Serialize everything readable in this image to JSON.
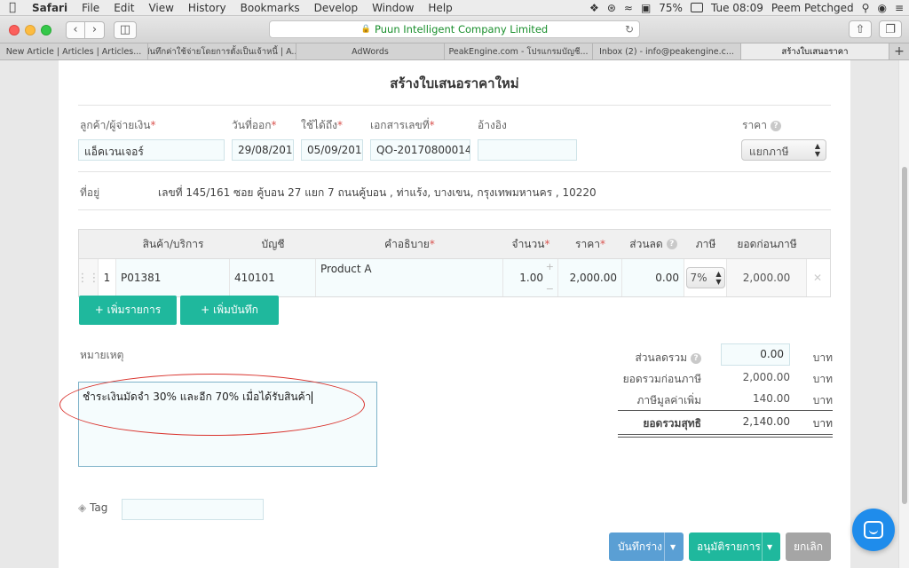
{
  "menubar": {
    "app": "Safari",
    "items": [
      "File",
      "Edit",
      "View",
      "History",
      "Bookmarks",
      "Develop",
      "Window",
      "Help"
    ],
    "battery": "75%",
    "clock": "Tue 08:09",
    "user": "Peem Petchged"
  },
  "browser": {
    "url": "Puun Intelligent Company Limited",
    "tabs": [
      "New Article | Articles | Articles...",
      "บันทึกค่าใช้จ่ายโดยการตั้งเป็นเจ้าหนี้ | A...",
      "AdWords",
      "PeakEngine.com - โปรแกรมบัญชี...",
      "Inbox (2) - info@peakengine.c...",
      "สร้างใบเสนอราคา"
    ],
    "active_tab": 5
  },
  "form": {
    "title": "สร้างใบเสนอราคาใหม่",
    "customer_label": "ลูกค้า/ผู้จ่ายเงิน",
    "customer_value": "แอ็คเวนเจอร์",
    "issue_date_label": "วันที่ออก",
    "issue_date_value": "29/08/2017",
    "valid_until_label": "ใช้ได้ถึง",
    "valid_until_value": "05/09/2017",
    "doc_no_label": "เอกสารเลขที่",
    "doc_no_value": "QO-20170800014",
    "reference_label": "อ้างอิง",
    "reference_value": "",
    "price_label": "ราคา",
    "price_type": "แยกภาษี",
    "address_label": "ที่อยู่",
    "address_value": "เลขที่ 145/161 ซอย คู้บอน 27 แยก 7 ถนนคู้บอน , ท่าแร้ง, บางเขน, กรุงเทพมหานคร , 10220"
  },
  "table": {
    "headers": {
      "product": "สินค้า/บริการ",
      "account": "บัญชี",
      "description": "คำอธิบาย",
      "qty": "จำนวน",
      "price": "ราคา",
      "discount": "ส่วนลด",
      "tax": "ภาษี",
      "pretax": "ยอดก่อนภาษี"
    },
    "rows": [
      {
        "no": "1",
        "product": "P01381",
        "account": "410101",
        "description": "Product A",
        "qty": "1.00",
        "price": "2,000.00",
        "discount": "0.00",
        "tax": "7%",
        "pretax": "2,000.00"
      }
    ],
    "add_item_label": "+ เพิ่มรายการ",
    "add_note_label": "+ เพิ่มบันทึก"
  },
  "remarks": {
    "label": "หมายเหตุ",
    "value": "ชำระเงินมัดจำ 30% และอีก 70% เมื่อได้รับสินค้า"
  },
  "summary": {
    "discount_label": "ส่วนลดรวม",
    "discount_value": "0.00",
    "pretax_label": "ยอดรวมก่อนภาษี",
    "pretax_value": "2,000.00",
    "vat_label": "ภาษีมูลค่าเพิ่ม",
    "vat_value": "140.00",
    "net_label": "ยอดรวมสุทธิ",
    "net_value": "2,140.00",
    "unit": "บาท"
  },
  "tag": {
    "label": "Tag",
    "value": ""
  },
  "actions": {
    "save_draft": "บันทึกร่าง",
    "approve": "อนุมัติรายการ",
    "cancel": "ยกเลิก"
  },
  "colors": {
    "accent": "#1fb89d",
    "draft_button": "#5a9fd4",
    "cancel_button": "#a5a5a5",
    "annotation": "#d9322c",
    "chat": "#1f8ceb"
  }
}
